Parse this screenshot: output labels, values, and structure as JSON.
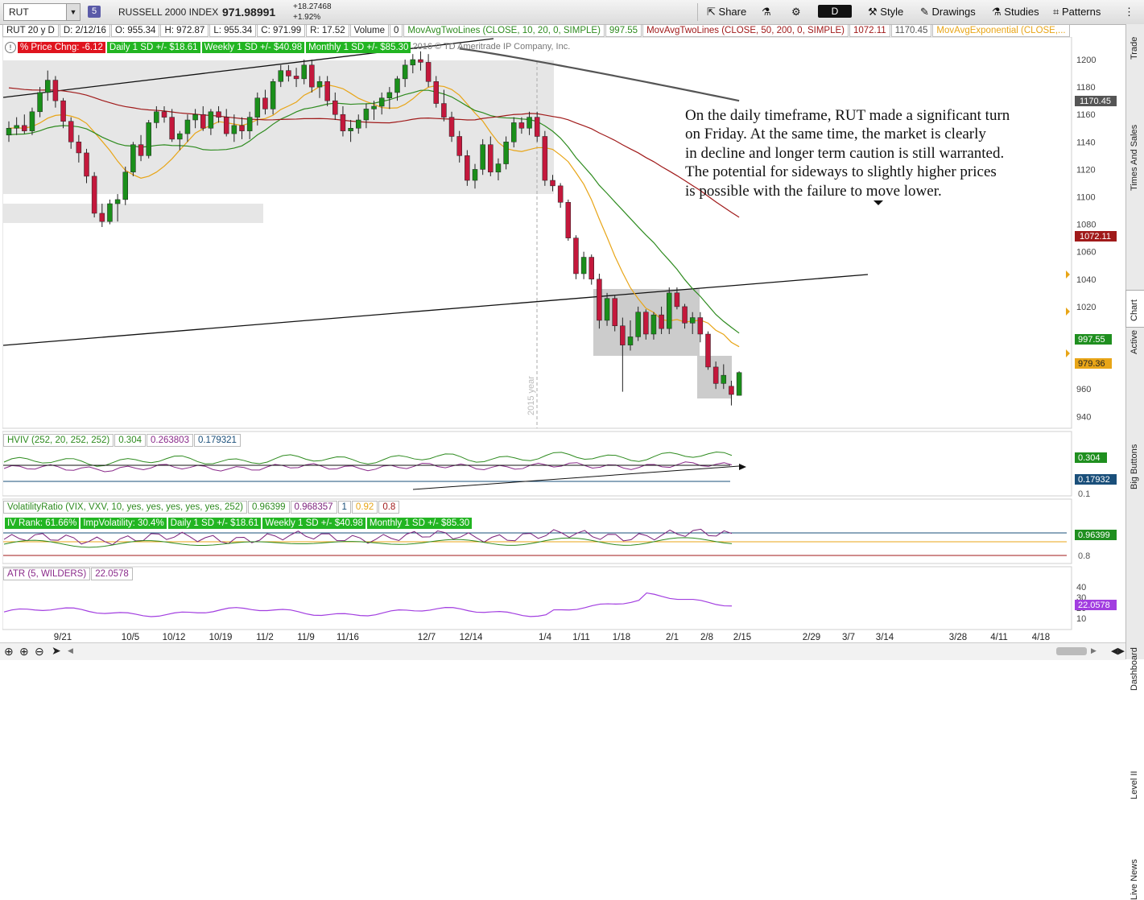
{
  "toolbar": {
    "symbol": "RUT",
    "link_group": "5",
    "index_name": "RUSSELL 2000 INDEX",
    "last_price": "971.98991",
    "change_abs": "+18.27468",
    "change_pct": "+1.92%",
    "share_label": "Share",
    "aggregation": "D",
    "style_label": "Style",
    "drawings_label": "Drawings",
    "studies_label": "Studies",
    "patterns_label": "Patterns"
  },
  "infobar": {
    "period": "RUT 20 y D",
    "date": "D: 2/12/16",
    "open": "O: 955.34",
    "high": "H: 972.87",
    "low": "L: 955.34",
    "close": "C: 971.99",
    "range": "R: 17.52",
    "volume_label": "Volume",
    "volume_value": "0",
    "ma1_label": "MovAvgTwoLines (CLOSE, 10, 20, 0, SIMPLE)",
    "ma1_value": "997.55",
    "ma2_label": "MovAvgTwoLines (CLOSE, 50, 200, 0, SIMPLE)",
    "ma2_value1": "1072.11",
    "ma2_value2": "1170.45",
    "ma3_label": "MovAvgExponential (CLOSE,..."
  },
  "price_pane": {
    "pct_chg": "% Price Chng: -6.12",
    "daily_sd": "Daily 1 SD +/- $18.61",
    "weekly_sd": "Weekly 1 SD +/- $40.98",
    "monthly_sd": "Monthly 1 SD +/- $85.30",
    "copyright": "2016 © TD Ameritrade IP Company, Inc.",
    "year_marker": "2015 year",
    "yticks": [
      "1200",
      "1180",
      "1160",
      "1140",
      "1120",
      "1100",
      "1080",
      "1060",
      "1040",
      "1020",
      "960",
      "940"
    ],
    "labels": {
      "l1170": "1170.45",
      "l1072": "1072.11",
      "l997": "997.55",
      "l979": "979.36"
    },
    "note_lines": [
      "On the daily timeframe, RUT made a significant turn",
      "on Friday.  At the same time, the market is clearly",
      "in decline and longer term caution is still warranted.",
      "The potential for sideways to slightly higher prices",
      "is possible with the failure to move lower."
    ]
  },
  "hviv_pane": {
    "title": "HVIV (252, 20, 252, 252)",
    "v1": "0.304",
    "v2": "0.263803",
    "v3": "0.179321",
    "label_hi": "0.304",
    "label_lo": "0.17932",
    "tick": "0.1"
  },
  "vr_pane": {
    "title": "VolatilityRatio (VIX, VXV, 10, yes, yes, yes, yes, yes, 252)",
    "v1": "0.96399",
    "v2": "0.968357",
    "v3": "1",
    "v4": "0.92",
    "v5": "0.8",
    "iv_rank": "IV Rank: 61.66%",
    "imp_vol": "ImpVolatility: 30.4%",
    "daily_sd": "Daily 1 SD +/- $18.61",
    "weekly_sd": "Weekly 1 SD +/- $40.98",
    "monthly_sd": "Monthly 1 SD +/- $85.30",
    "label": "0.96399",
    "tick": "0.8"
  },
  "atr_pane": {
    "title": "ATR (5, WILDERS)",
    "value": "22.0578",
    "label": "22.0578",
    "yticks": [
      "40",
      "30",
      "20",
      "10"
    ]
  },
  "xaxis": [
    "9/21",
    "10/5",
    "10/12",
    "10/19",
    "11/2",
    "11/9",
    "11/16",
    "12/7",
    "12/14",
    "1/4",
    "1/11",
    "1/18",
    "2/1",
    "2/8",
    "2/15",
    "2/29",
    "3/7",
    "3/14",
    "3/28",
    "4/11",
    "4/18"
  ],
  "right_tabs": [
    "Trade",
    "Times And Sales",
    "Active Trader",
    "Big Buttons",
    "Chart",
    "Dashboard",
    "Level II",
    "Live News"
  ],
  "colors": {
    "up": "#1a8f1a",
    "down": "#c4183c",
    "ma10": "#e8a517",
    "ma20": "#2e8b1f",
    "ma50": "#a01a1a",
    "ma200": "#555555",
    "badge_green": "#22b522",
    "badge_red": "#e0141e"
  },
  "chart_data": {
    "type": "candlestick",
    "symbol": "RUT",
    "aggregation": "daily",
    "ylim": [
      930,
      1210
    ],
    "ohlc": [
      {
        "o": 1145,
        "h": 1155,
        "l": 1140,
        "c": 1150
      },
      {
        "o": 1150,
        "h": 1158,
        "l": 1145,
        "c": 1152
      },
      {
        "o": 1152,
        "h": 1160,
        "l": 1146,
        "c": 1148
      },
      {
        "o": 1148,
        "h": 1165,
        "l": 1145,
        "c": 1162
      },
      {
        "o": 1162,
        "h": 1180,
        "l": 1158,
        "c": 1176
      },
      {
        "o": 1176,
        "h": 1192,
        "l": 1170,
        "c": 1185
      },
      {
        "o": 1185,
        "h": 1188,
        "l": 1165,
        "c": 1170
      },
      {
        "o": 1170,
        "h": 1172,
        "l": 1150,
        "c": 1155
      },
      {
        "o": 1155,
        "h": 1158,
        "l": 1135,
        "c": 1140
      },
      {
        "o": 1140,
        "h": 1145,
        "l": 1125,
        "c": 1132
      },
      {
        "o": 1132,
        "h": 1135,
        "l": 1110,
        "c": 1115
      },
      {
        "o": 1115,
        "h": 1118,
        "l": 1085,
        "c": 1088
      },
      {
        "o": 1088,
        "h": 1095,
        "l": 1078,
        "c": 1082
      },
      {
        "o": 1082,
        "h": 1098,
        "l": 1080,
        "c": 1095
      },
      {
        "o": 1095,
        "h": 1102,
        "l": 1082,
        "c": 1098
      },
      {
        "o": 1098,
        "h": 1122,
        "l": 1094,
        "c": 1118
      },
      {
        "o": 1118,
        "h": 1140,
        "l": 1115,
        "c": 1138
      },
      {
        "o": 1138,
        "h": 1145,
        "l": 1126,
        "c": 1130
      },
      {
        "o": 1130,
        "h": 1156,
        "l": 1128,
        "c": 1154
      },
      {
        "o": 1154,
        "h": 1166,
        "l": 1150,
        "c": 1162
      },
      {
        "o": 1162,
        "h": 1166,
        "l": 1154,
        "c": 1158
      },
      {
        "o": 1158,
        "h": 1164,
        "l": 1140,
        "c": 1142
      },
      {
        "o": 1142,
        "h": 1148,
        "l": 1134,
        "c": 1146
      },
      {
        "o": 1146,
        "h": 1160,
        "l": 1140,
        "c": 1156
      },
      {
        "o": 1156,
        "h": 1164,
        "l": 1150,
        "c": 1160
      },
      {
        "o": 1160,
        "h": 1166,
        "l": 1148,
        "c": 1150
      },
      {
        "o": 1150,
        "h": 1164,
        "l": 1145,
        "c": 1162
      },
      {
        "o": 1162,
        "h": 1166,
        "l": 1154,
        "c": 1158
      },
      {
        "o": 1158,
        "h": 1164,
        "l": 1144,
        "c": 1146
      },
      {
        "o": 1146,
        "h": 1160,
        "l": 1140,
        "c": 1152
      },
      {
        "o": 1152,
        "h": 1158,
        "l": 1142,
        "c": 1148
      },
      {
        "o": 1148,
        "h": 1162,
        "l": 1142,
        "c": 1158
      },
      {
        "o": 1158,
        "h": 1176,
        "l": 1152,
        "c": 1172
      },
      {
        "o": 1172,
        "h": 1178,
        "l": 1160,
        "c": 1164
      },
      {
        "o": 1164,
        "h": 1186,
        "l": 1160,
        "c": 1184
      },
      {
        "o": 1184,
        "h": 1196,
        "l": 1180,
        "c": 1192
      },
      {
        "o": 1192,
        "h": 1196,
        "l": 1184,
        "c": 1188
      },
      {
        "o": 1188,
        "h": 1194,
        "l": 1180,
        "c": 1186
      },
      {
        "o": 1186,
        "h": 1200,
        "l": 1182,
        "c": 1196
      },
      {
        "o": 1196,
        "h": 1200,
        "l": 1176,
        "c": 1180
      },
      {
        "o": 1180,
        "h": 1188,
        "l": 1172,
        "c": 1184
      },
      {
        "o": 1184,
        "h": 1188,
        "l": 1166,
        "c": 1170
      },
      {
        "o": 1170,
        "h": 1176,
        "l": 1156,
        "c": 1160
      },
      {
        "o": 1160,
        "h": 1166,
        "l": 1144,
        "c": 1148
      },
      {
        "o": 1148,
        "h": 1156,
        "l": 1140,
        "c": 1150
      },
      {
        "o": 1150,
        "h": 1160,
        "l": 1146,
        "c": 1156
      },
      {
        "o": 1156,
        "h": 1168,
        "l": 1150,
        "c": 1164
      },
      {
        "o": 1164,
        "h": 1170,
        "l": 1156,
        "c": 1166
      },
      {
        "o": 1166,
        "h": 1176,
        "l": 1160,
        "c": 1172
      },
      {
        "o": 1172,
        "h": 1180,
        "l": 1164,
        "c": 1176
      },
      {
        "o": 1176,
        "h": 1188,
        "l": 1170,
        "c": 1186
      },
      {
        "o": 1186,
        "h": 1200,
        "l": 1180,
        "c": 1196
      },
      {
        "o": 1196,
        "h": 1204,
        "l": 1190,
        "c": 1200
      },
      {
        "o": 1200,
        "h": 1206,
        "l": 1192,
        "c": 1198
      },
      {
        "o": 1198,
        "h": 1204,
        "l": 1180,
        "c": 1184
      },
      {
        "o": 1184,
        "h": 1188,
        "l": 1165,
        "c": 1168
      },
      {
        "o": 1168,
        "h": 1178,
        "l": 1155,
        "c": 1158
      },
      {
        "o": 1158,
        "h": 1162,
        "l": 1140,
        "c": 1144
      },
      {
        "o": 1144,
        "h": 1148,
        "l": 1125,
        "c": 1130
      },
      {
        "o": 1130,
        "h": 1134,
        "l": 1108,
        "c": 1112
      },
      {
        "o": 1112,
        "h": 1124,
        "l": 1106,
        "c": 1120
      },
      {
        "o": 1120,
        "h": 1142,
        "l": 1116,
        "c": 1138
      },
      {
        "o": 1138,
        "h": 1144,
        "l": 1115,
        "c": 1118
      },
      {
        "o": 1118,
        "h": 1128,
        "l": 1112,
        "c": 1124
      },
      {
        "o": 1124,
        "h": 1144,
        "l": 1120,
        "c": 1140
      },
      {
        "o": 1140,
        "h": 1158,
        "l": 1136,
        "c": 1154
      },
      {
        "o": 1154,
        "h": 1158,
        "l": 1146,
        "c": 1150
      },
      {
        "o": 1150,
        "h": 1162,
        "l": 1145,
        "c": 1158
      },
      {
        "o": 1158,
        "h": 1162,
        "l": 1140,
        "c": 1144
      },
      {
        "o": 1144,
        "h": 1148,
        "l": 1108,
        "c": 1112
      },
      {
        "o": 1112,
        "h": 1116,
        "l": 1104,
        "c": 1108
      },
      {
        "o": 1108,
        "h": 1110,
        "l": 1092,
        "c": 1096
      },
      {
        "o": 1096,
        "h": 1098,
        "l": 1068,
        "c": 1070
      },
      {
        "o": 1070,
        "h": 1072,
        "l": 1040,
        "c": 1044
      },
      {
        "o": 1044,
        "h": 1060,
        "l": 1040,
        "c": 1056
      },
      {
        "o": 1056,
        "h": 1058,
        "l": 1036,
        "c": 1040
      },
      {
        "o": 1040,
        "h": 1044,
        "l": 1004,
        "c": 1010
      },
      {
        "o": 1010,
        "h": 1030,
        "l": 1006,
        "c": 1026
      },
      {
        "o": 1026,
        "h": 1028,
        "l": 1002,
        "c": 1006
      },
      {
        "o": 1006,
        "h": 1012,
        "l": 958,
        "c": 992
      },
      {
        "o": 992,
        "h": 1010,
        "l": 988,
        "c": 998
      },
      {
        "o": 998,
        "h": 1020,
        "l": 995,
        "c": 1016
      },
      {
        "o": 1016,
        "h": 1018,
        "l": 996,
        "c": 1000
      },
      {
        "o": 1000,
        "h": 1016,
        "l": 996,
        "c": 1014
      },
      {
        "o": 1014,
        "h": 1020,
        "l": 1000,
        "c": 1004
      },
      {
        "o": 1004,
        "h": 1034,
        "l": 1000,
        "c": 1030
      },
      {
        "o": 1030,
        "h": 1034,
        "l": 1018,
        "c": 1020
      },
      {
        "o": 1020,
        "h": 1022,
        "l": 1004,
        "c": 1008
      },
      {
        "o": 1008,
        "h": 1016,
        "l": 1000,
        "c": 1012
      },
      {
        "o": 1012,
        "h": 1016,
        "l": 994,
        "c": 1000
      },
      {
        "o": 1000,
        "h": 1002,
        "l": 974,
        "c": 976
      },
      {
        "o": 976,
        "h": 980,
        "l": 960,
        "c": 964
      },
      {
        "o": 964,
        "h": 978,
        "l": 960,
        "c": 970
      },
      {
        "o": 962,
        "h": 966,
        "l": 948,
        "c": 956
      },
      {
        "o": 955.34,
        "h": 972.87,
        "l": 955.34,
        "c": 971.99
      }
    ],
    "xlabels": [
      "9/21",
      "10/5",
      "10/12",
      "10/19",
      "11/2",
      "11/9",
      "11/16",
      "12/7",
      "12/14",
      "1/4",
      "1/11",
      "1/18",
      "2/1",
      "2/8",
      "2/15",
      "2/29",
      "3/7",
      "3/14",
      "3/28",
      "4/11",
      "4/18"
    ],
    "ma_last": {
      "ma10": 979.36,
      "ma20": 997.55,
      "ma50": 1072.11,
      "ma200": 1170.45
    },
    "last": {
      "date": "2/12/16",
      "o": 955.34,
      "h": 972.87,
      "l": 955.34,
      "c": 971.99
    }
  }
}
